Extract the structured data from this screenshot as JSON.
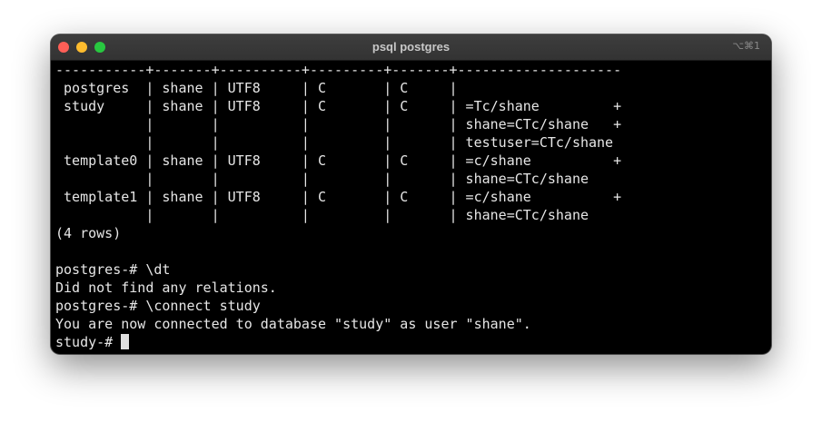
{
  "window": {
    "title": "psql postgres",
    "shortcut": "⌥⌘1"
  },
  "terminal": {
    "lines": [
      "-----------+-------+----------+---------+-------+--------------------",
      " postgres  | shane | UTF8     | C       | C     |",
      " study     | shane | UTF8     | C       | C     | =Tc/shane         +",
      "           |       |          |         |       | shane=CTc/shane   +",
      "           |       |          |         |       | testuser=CTc/shane",
      " template0 | shane | UTF8     | C       | C     | =c/shane          +",
      "           |       |          |         |       | shane=CTc/shane",
      " template1 | shane | UTF8     | C       | C     | =c/shane          +",
      "           |       |          |         |       | shane=CTc/shane",
      "(4 rows)",
      "",
      "postgres-# \\dt",
      "Did not find any relations.",
      "postgres-# \\connect study",
      "You are now connected to database \"study\" as user \"shane\".",
      "study-# "
    ]
  }
}
